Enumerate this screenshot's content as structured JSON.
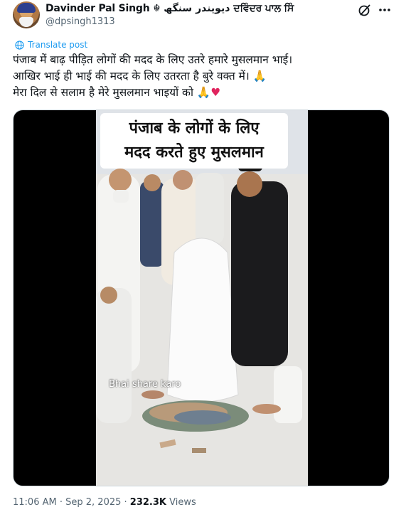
{
  "author": {
    "name": "Davinder Pal Singh",
    "name_emoji": "☬",
    "name_urdu": "دیویندر سنگھ",
    "name_punjabi": "ਦਵਿੰਦਰ ਪਾਲ ਸਿੰ",
    "handle": "@dpsingh1313"
  },
  "actions": {
    "translate_label": "Translate post"
  },
  "post": {
    "line1": "पंजाब में बाढ़ पीड़ित लोगों की मदद के लिए उतरे हमारे मुसलमान भाई।",
    "line2": "आखिर भाई ही भाई की मदद के लिए उतरता है बुरे वक्त में।",
    "line2_emoji": "🙏",
    "line3": "मेरा दिल से सलाम है मेरे मुसलमान भाइयों को",
    "line3_emoji": "🙏",
    "line3_heart": "♥"
  },
  "media": {
    "caption_line1": "पंजाब के लोगों के लिए",
    "caption_line2": "मदद करते हुए मुसलमान",
    "overlay_text": "Bhai share karo"
  },
  "meta": {
    "time": "11:06 AM",
    "sep1": " · ",
    "date": "Sep 2, 2025",
    "sep2": " · ",
    "views_count": "232.3K",
    "views_label": " Views"
  },
  "colors": {
    "link": "#1d9bf0",
    "secondary_text": "#536471",
    "primary_text": "#0f1419",
    "heart": "#e0245e"
  },
  "icons": {
    "grok": "grok-icon",
    "more": "more-icon",
    "translate": "globe-icon"
  }
}
